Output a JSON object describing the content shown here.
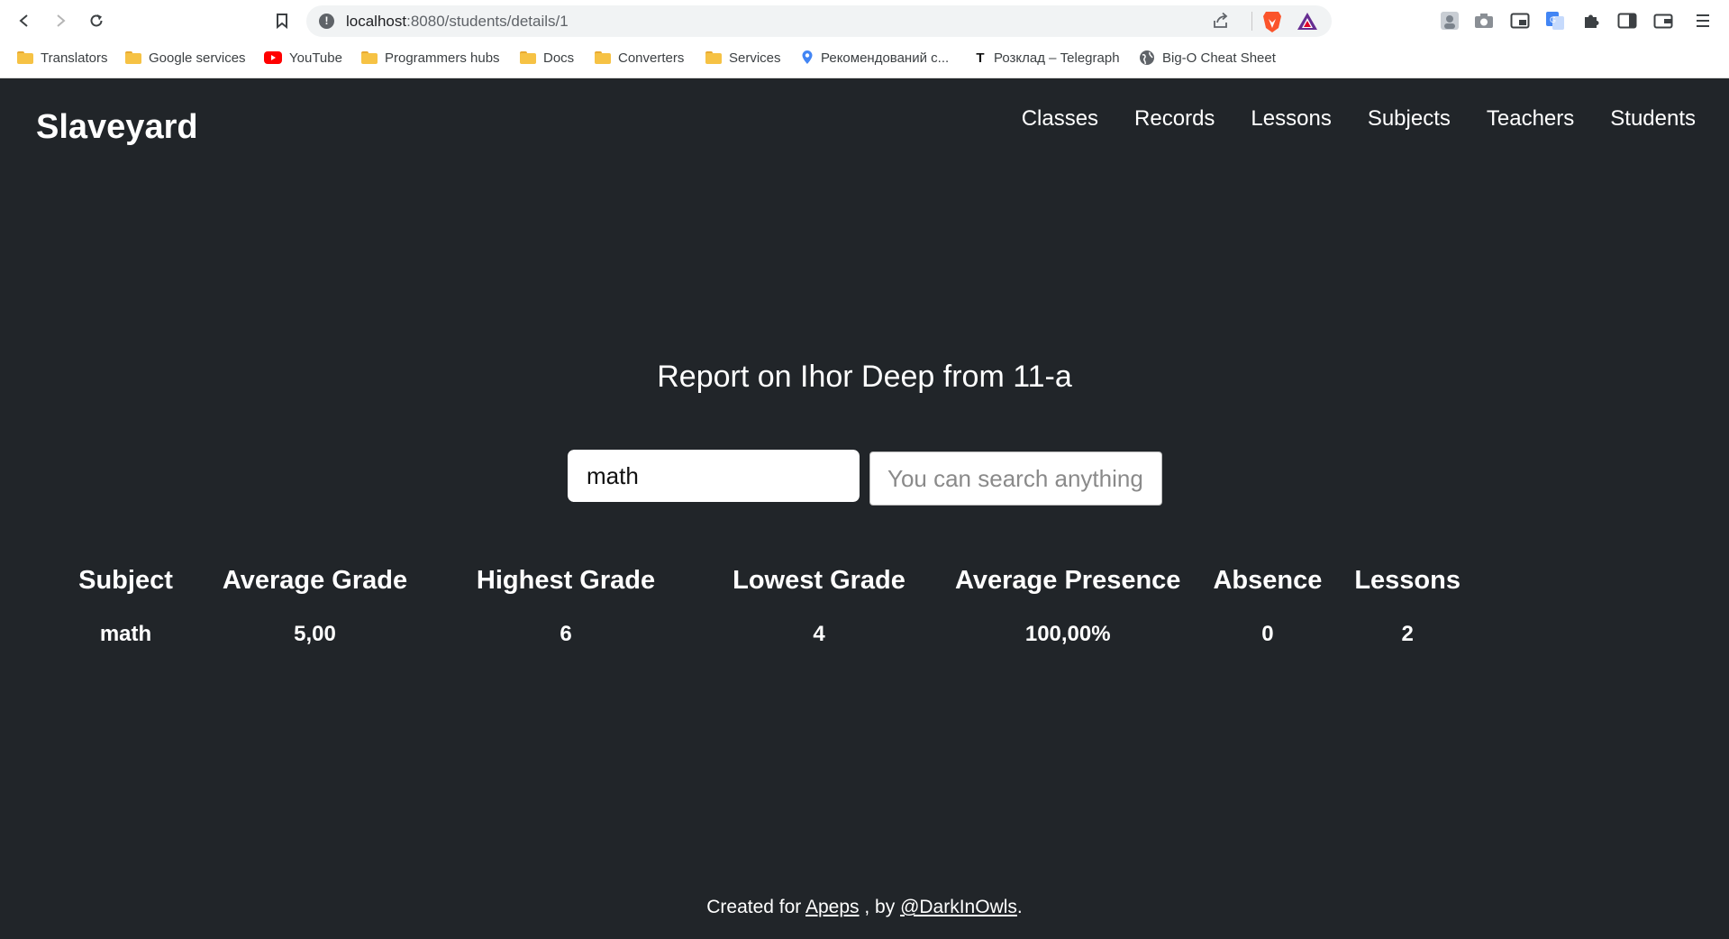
{
  "browser": {
    "url_host": "localhost",
    "url_rest": ":8080/students/details/1",
    "bookmarks": [
      {
        "label": "Translators",
        "icon": "folder-icon"
      },
      {
        "label": "Google services",
        "icon": "folder-icon"
      },
      {
        "label": "YouTube",
        "icon": "youtube-icon"
      },
      {
        "label": "Programmers hubs",
        "icon": "folder-icon"
      },
      {
        "label": "Docs",
        "icon": "folder-icon"
      },
      {
        "label": "Converters",
        "icon": "folder-icon"
      },
      {
        "label": "Services",
        "icon": "folder-icon"
      },
      {
        "label": "Рекомендований с...",
        "icon": "location-pin-icon"
      },
      {
        "label": "Розклад – Telegraph",
        "icon": "telegraph-icon"
      },
      {
        "label": "Big-O Cheat Sheet",
        "icon": "globe-icon"
      }
    ]
  },
  "navbar": {
    "brand": "Slaveyard",
    "links": [
      "Classes",
      "Records",
      "Lessons",
      "Subjects",
      "Teachers",
      "Students"
    ]
  },
  "report": {
    "title": "Report on Ihor Deep from 11-a",
    "filter_value": "math",
    "search_placeholder": "You can search anything!"
  },
  "table": {
    "headers": [
      "Subject",
      "Average Grade",
      "Highest Grade",
      "Lowest Grade",
      "Average Presence",
      "Absence",
      "Lessons"
    ],
    "rows": [
      [
        "math",
        "5,00",
        "6",
        "4",
        "100,00%",
        "0",
        "2"
      ]
    ]
  },
  "footer": {
    "prefix": "Created for ",
    "link1": "Apeps",
    "middle": " , by ",
    "link2": "@DarkInOwls",
    "suffix": "."
  }
}
